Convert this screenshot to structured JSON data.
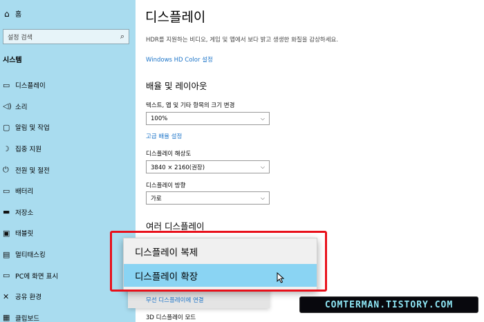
{
  "sidebar": {
    "home_label": "홈",
    "search_placeholder": "설정 검색",
    "section_title": "시스템",
    "items": [
      {
        "label": "디스플레이",
        "icon": "monitor-icon"
      },
      {
        "label": "소리",
        "icon": "speaker-icon"
      },
      {
        "label": "알림 및 작업",
        "icon": "notification-icon"
      },
      {
        "label": "집중 지원",
        "icon": "moon-icon"
      },
      {
        "label": "전원 및 절전",
        "icon": "power-icon"
      },
      {
        "label": "배터리",
        "icon": "battery-icon"
      },
      {
        "label": "저장소",
        "icon": "storage-icon"
      },
      {
        "label": "태블릿",
        "icon": "tablet-icon"
      },
      {
        "label": "멀티태스킹",
        "icon": "multitasking-icon"
      },
      {
        "label": "PC에 화면 표시",
        "icon": "project-icon"
      },
      {
        "label": "공유 환경",
        "icon": "share-icon"
      },
      {
        "label": "클립보드",
        "icon": "clipboard-icon"
      }
    ]
  },
  "main": {
    "title": "디스플레이",
    "hdr_description": "HDR를 지원하는 비디오, 게임 및 앱에서 보다 밝고 생생한 화질을 감상하세요.",
    "hdr_link": "Windows HD Color 설정",
    "scale_heading": "배율 및 레이아웃",
    "scale_label": "텍스트, 앱 및 기타 항목의 크기 변경",
    "scale_value": "100%",
    "advanced_scale_link": "고급 배율 설정",
    "resolution_label": "디스플레이 해상도",
    "resolution_value": "3840 × 2160(권장)",
    "orientation_label": "디스플레이 방향",
    "orientation_value": "가로",
    "multi_heading": "여러 디스플레이",
    "wireless_link": "무선 디스플레이에 연결",
    "display_3d_label": "3D 디스플레이 모드"
  },
  "popup": {
    "options": [
      "디스플레이 복제",
      "디스플레이 확장"
    ],
    "selected_index": 1
  },
  "watermark": "COMTERMAN.TISTORY.COM",
  "colors": {
    "sidebar_bg": "#a9dcef",
    "link": "#1a73c8",
    "selected": "#8ad4f3",
    "highlight_border": "#e8101a"
  }
}
